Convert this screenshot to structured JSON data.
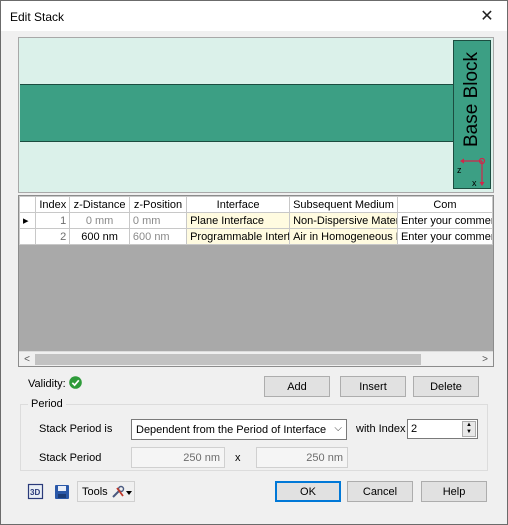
{
  "window": {
    "title": "Edit Stack",
    "close_glyph": "✕"
  },
  "visualization": {
    "base_block_label": "Base Block",
    "axis_z": "z",
    "axis_x": "x",
    "layer_color": "#3c9f84",
    "background_color": "#dbf1ea"
  },
  "grid": {
    "columns": [
      "Index",
      "z-Distance",
      "z-Position",
      "Interface",
      "Subsequent Medium",
      "Com"
    ],
    "rows": [
      {
        "indicator": "▸",
        "index": "1",
        "z_distance": "0 mm",
        "z_position": "0 mm",
        "interface": "Plane Interface",
        "medium": "Non-Dispersive Materi",
        "comment": "Enter your comment"
      },
      {
        "indicator": "",
        "index": "2",
        "z_distance": "600 nm",
        "z_position": "600 nm",
        "interface": "Programmable Interfac",
        "medium": "Air in Homogeneous M",
        "comment": "Enter your comment"
      }
    ],
    "scroll_left": "<",
    "scroll_right": ">"
  },
  "validity": {
    "label": "Validity:",
    "status": "valid"
  },
  "actions": {
    "add": "Add",
    "insert": "Insert",
    "delete": "Delete"
  },
  "period": {
    "group_title": "Period",
    "stack_period_label": "Stack Period is",
    "stack_period_value": "Dependent from the Period of Interface",
    "with_index_label": "with Index",
    "with_index_value": "2",
    "stack_period_size_label": "Stack Period",
    "period_x": "250 nm",
    "times": "x",
    "period_y": "250 nm"
  },
  "footer": {
    "tools_label": "Tools",
    "ok": "OK",
    "cancel": "Cancel",
    "help": "Help"
  }
}
